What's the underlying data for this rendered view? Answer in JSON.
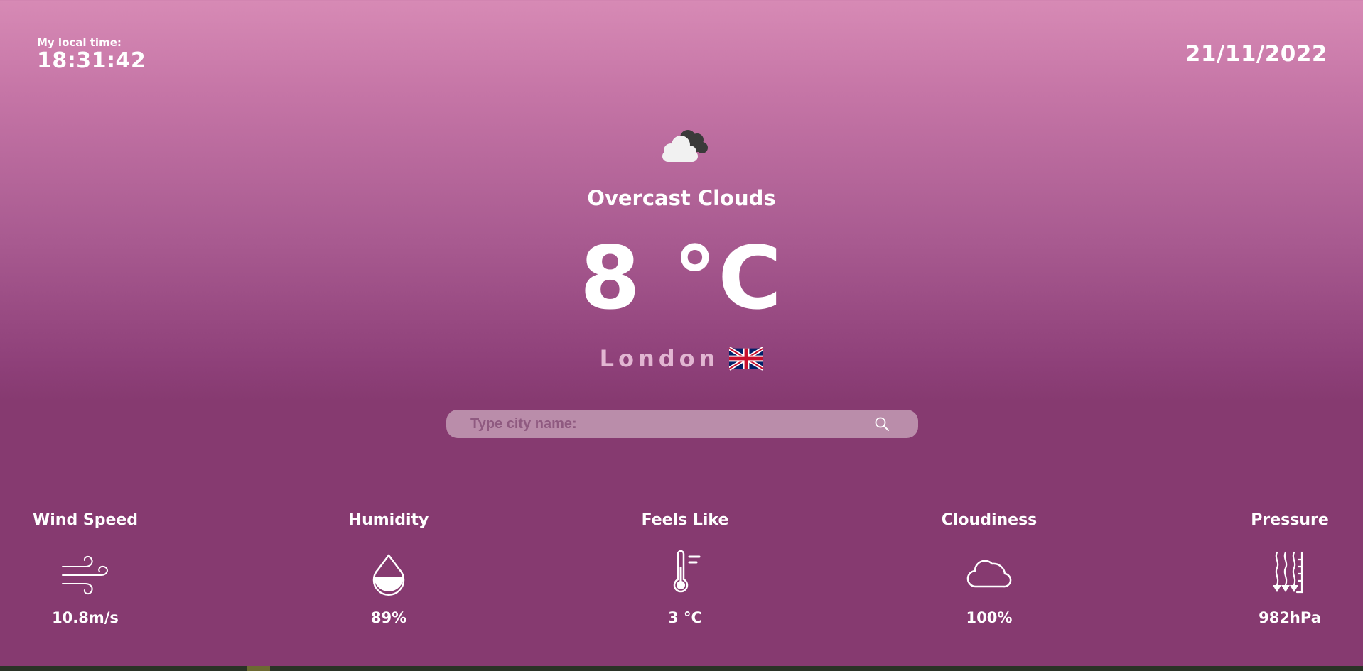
{
  "header": {
    "local_time_label": "My local time:",
    "local_time": "18:31:42",
    "date": "21/11/2022"
  },
  "current": {
    "icon": "overcast-clouds-icon",
    "description": "Overcast Clouds",
    "temperature": "8 °C",
    "city": "London",
    "country_flag": "uk-flag-icon"
  },
  "search": {
    "placeholder": "Type city name:",
    "value": "",
    "icon": "search-icon"
  },
  "metrics": [
    {
      "label": "Wind Speed",
      "icon": "wind-icon",
      "value": "10.8m/s"
    },
    {
      "label": "Humidity",
      "icon": "water-drop-icon",
      "value": "89%"
    },
    {
      "label": "Feels Like",
      "icon": "thermometer-icon",
      "value": "3 °C"
    },
    {
      "label": "Cloudiness",
      "icon": "cloud-icon",
      "value": "100%"
    },
    {
      "label": "Pressure",
      "icon": "pressure-icon",
      "value": "982hPa"
    }
  ],
  "colors": {
    "background_top": "#d78ab5",
    "background_bottom": "#863a70",
    "search_bg": "#ba8daa",
    "city_text": "#e2b6d2"
  }
}
